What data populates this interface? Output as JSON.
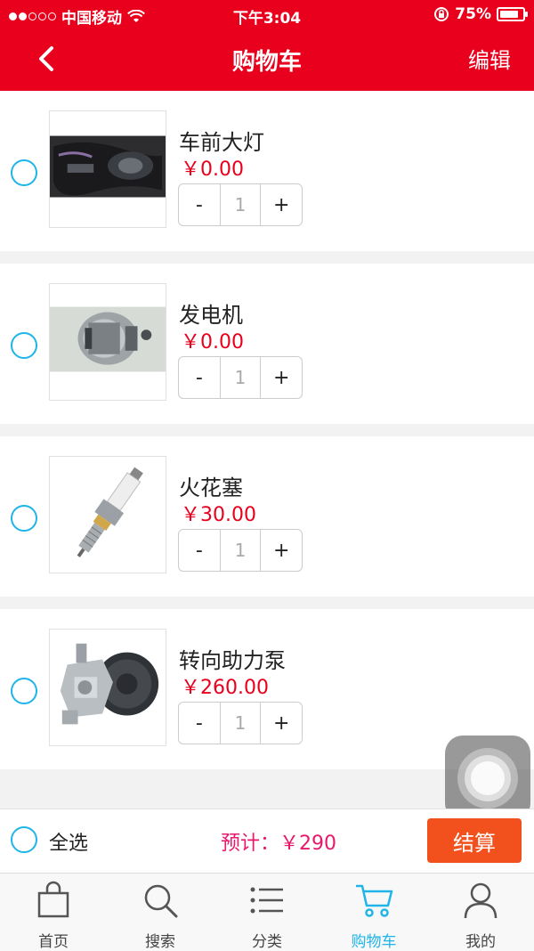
{
  "status_bar": {
    "carrier": "中国移动",
    "time": "下午3:04",
    "battery": "75%",
    "signal_dots_filled": 2,
    "signal_dots_total": 5
  },
  "nav": {
    "title": "购物车",
    "edit_label": "编辑",
    "back_icon": "chevron-left-icon"
  },
  "cart": {
    "items": [
      {
        "name": "车前大灯",
        "price": "￥0.00",
        "qty": "1",
        "minus": "-",
        "plus": "+"
      },
      {
        "name": "发电机",
        "price": "￥0.00",
        "qty": "1",
        "minus": "-",
        "plus": "+"
      },
      {
        "name": "火花塞",
        "price": "￥30.00",
        "qty": "1",
        "minus": "-",
        "plus": "+"
      },
      {
        "name": "转向助力泵",
        "price": "￥260.00",
        "qty": "1",
        "minus": "-",
        "plus": "+"
      }
    ]
  },
  "summary": {
    "select_all": "全选",
    "estimate": "预计：￥290",
    "checkout": "结算"
  },
  "tabs": [
    {
      "label": "首页",
      "icon": "bag-icon",
      "active": false
    },
    {
      "label": "搜索",
      "icon": "search-icon",
      "active": false
    },
    {
      "label": "分类",
      "icon": "list-icon",
      "active": false
    },
    {
      "label": "购物车",
      "icon": "cart-icon",
      "active": true
    },
    {
      "label": "我的",
      "icon": "user-icon",
      "active": false
    }
  ],
  "colors": {
    "brand_red": "#e8001c",
    "accent_blue": "#1fb5e8",
    "price_red": "#e8001c",
    "estimate_pink": "#e6196b",
    "checkout_orange": "#f2501c"
  }
}
